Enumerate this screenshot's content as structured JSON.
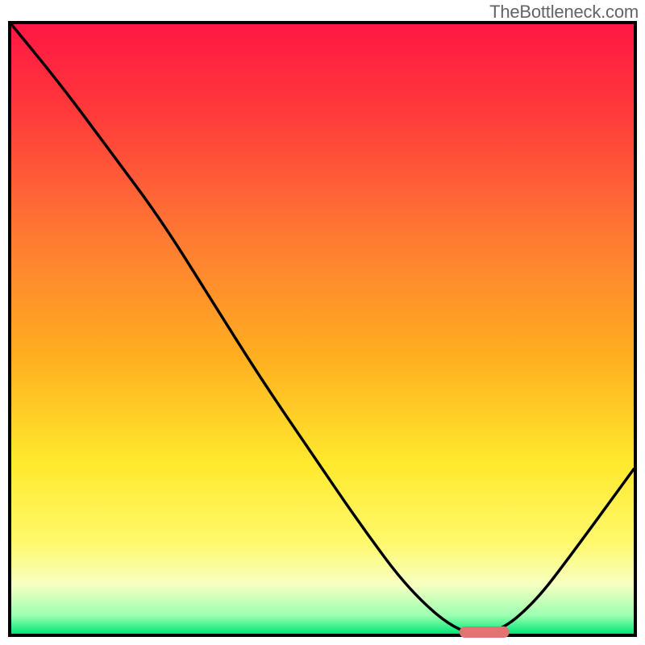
{
  "watermark": "TheBottleneck.com",
  "chart_data": {
    "type": "line",
    "title": "",
    "xlabel": "",
    "ylabel": "",
    "xlim": [
      0,
      100
    ],
    "ylim": [
      0,
      100
    ],
    "x": [
      0,
      8,
      16,
      24,
      32,
      40,
      48,
      56,
      64,
      72,
      78,
      84,
      90,
      100
    ],
    "values": [
      100,
      90,
      79,
      68,
      55,
      42,
      30,
      18,
      7,
      0,
      0,
      5,
      13,
      27
    ],
    "marker": {
      "x_start": 72,
      "x_end": 80,
      "y": 0
    },
    "gradient_stops": [
      {
        "offset": 0.0,
        "color": "#ff1744"
      },
      {
        "offset": 0.15,
        "color": "#ff3b3b"
      },
      {
        "offset": 0.35,
        "color": "#ff7a33"
      },
      {
        "offset": 0.55,
        "color": "#ffb020"
      },
      {
        "offset": 0.72,
        "color": "#ffe92e"
      },
      {
        "offset": 0.85,
        "color": "#fff96b"
      },
      {
        "offset": 0.92,
        "color": "#f6ffc2"
      },
      {
        "offset": 0.97,
        "color": "#9bffb0"
      },
      {
        "offset": 1.0,
        "color": "#00e676"
      }
    ]
  }
}
